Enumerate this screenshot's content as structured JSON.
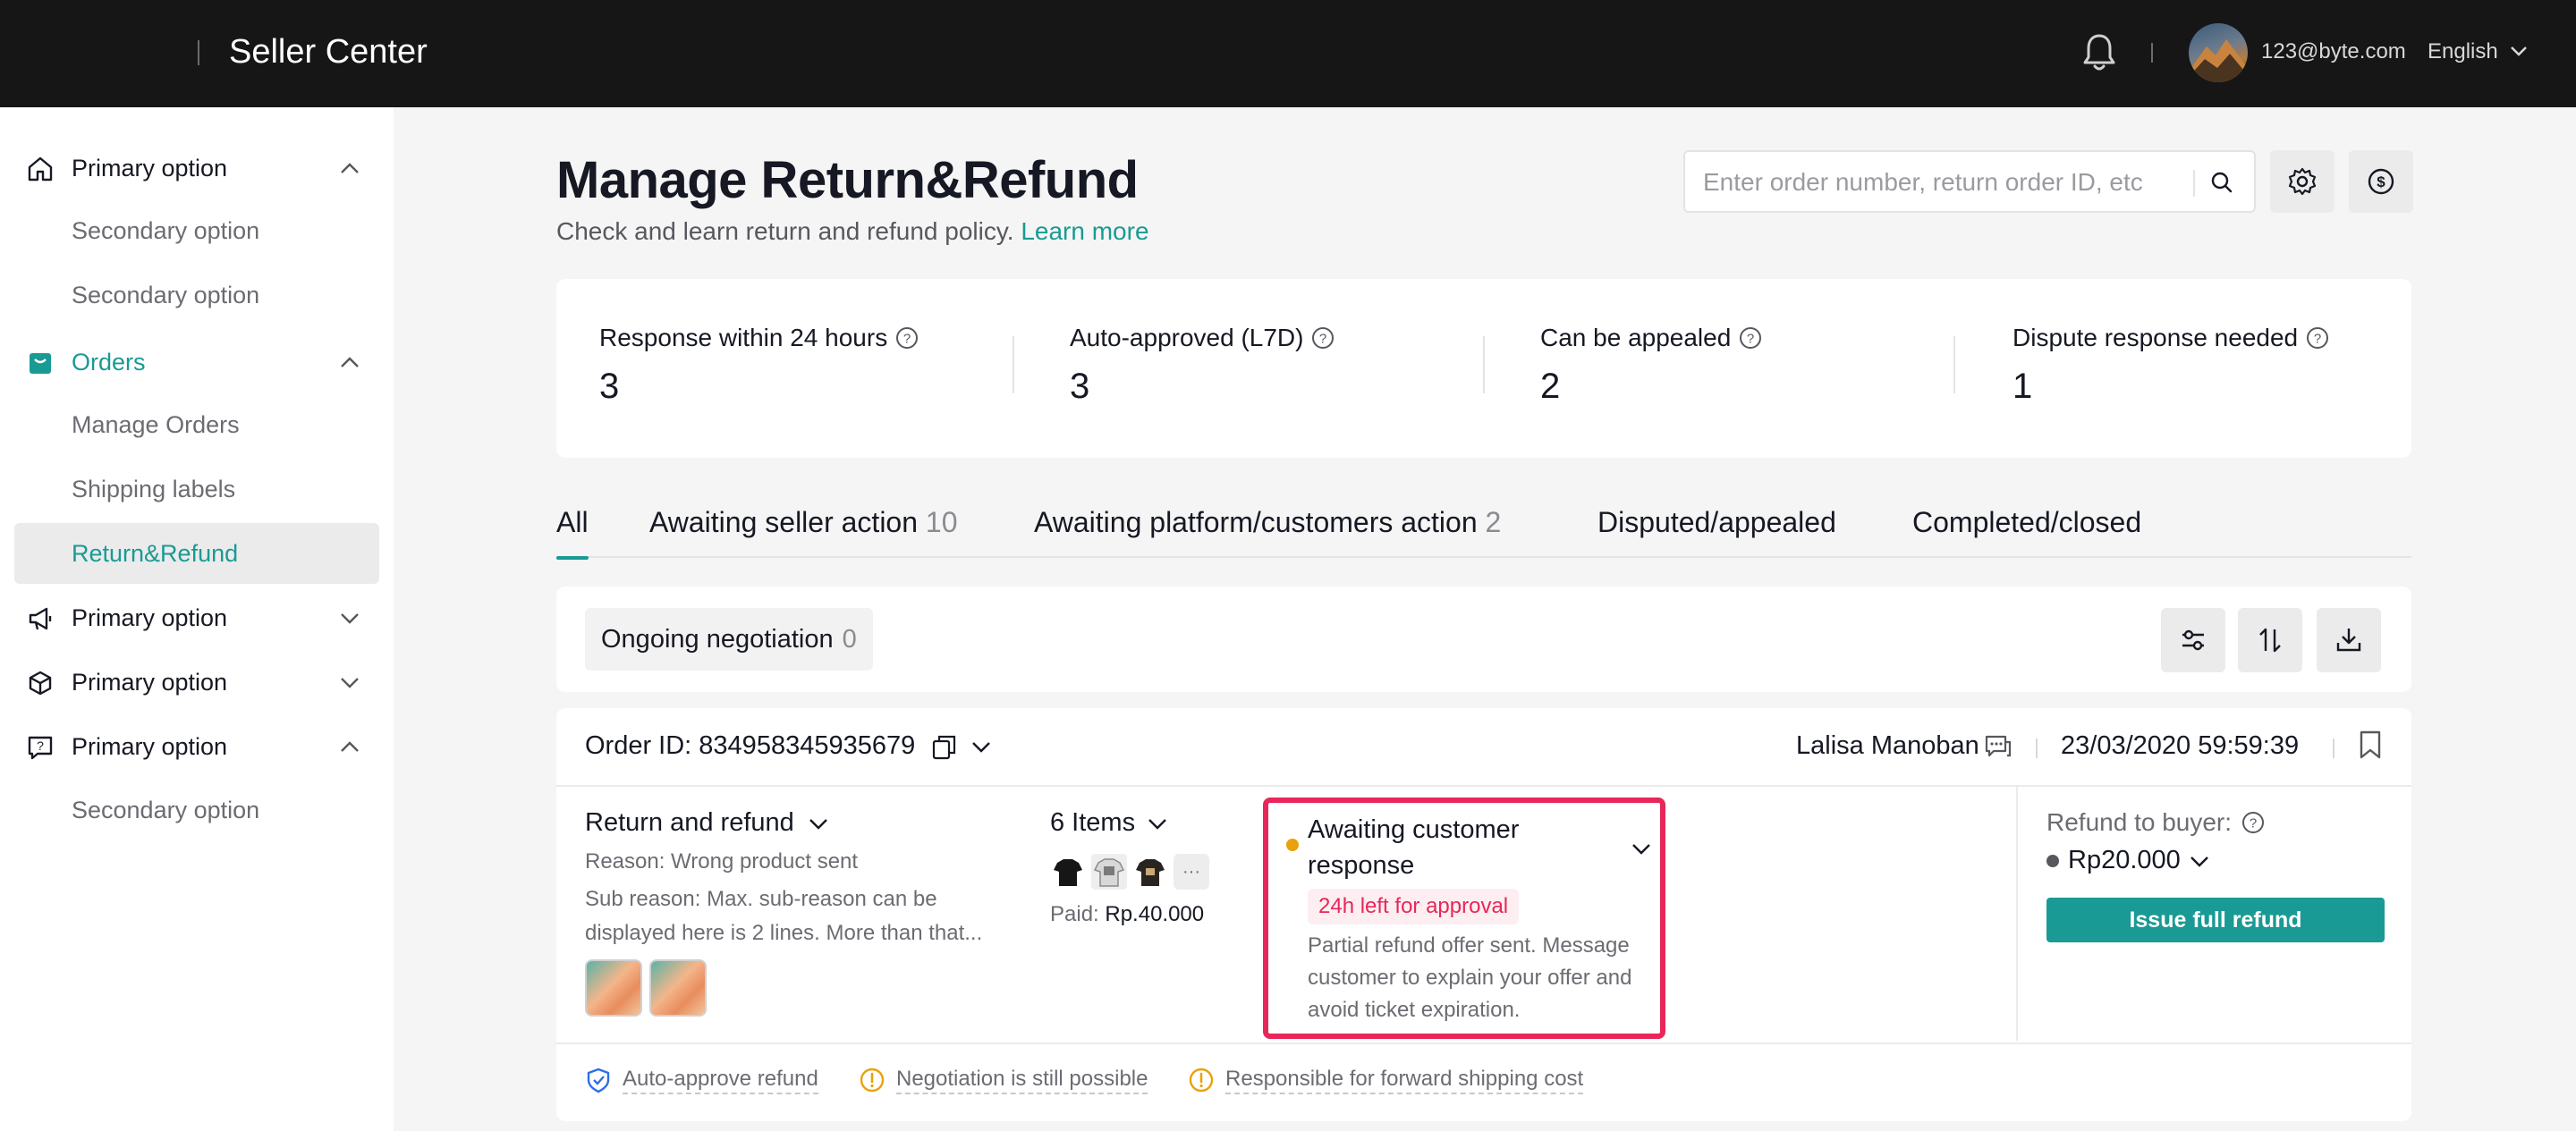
{
  "header": {
    "brand": "Seller Center",
    "email": "123@byte.com",
    "language": "English"
  },
  "sidebar": {
    "items": [
      {
        "label": "Primary option",
        "icon": "home-icon",
        "expanded": true
      },
      {
        "label": "Secondary option"
      },
      {
        "label": "Secondary option"
      },
      {
        "label": "Orders",
        "icon": "orders-icon",
        "expanded": true,
        "active": true
      },
      {
        "label": "Manage Orders"
      },
      {
        "label": "Shipping labels"
      },
      {
        "label": "Return&Refund",
        "active": true
      },
      {
        "label": "Primary option",
        "icon": "megaphone-icon",
        "expanded": false
      },
      {
        "label": "Primary option",
        "icon": "box-icon",
        "expanded": false
      },
      {
        "label": "Primary option",
        "icon": "help-chat-icon",
        "expanded": true
      },
      {
        "label": "Secondary option"
      }
    ]
  },
  "page": {
    "title": "Manage Return&Refund",
    "subtitle": "Check and learn return and refund policy.",
    "learn_more": "Learn more"
  },
  "search": {
    "placeholder": "Enter order number, return order ID, etc"
  },
  "stats": [
    {
      "label": "Response within 24 hours",
      "value": "3"
    },
    {
      "label": "Auto-approved (L7D)",
      "value": "3"
    },
    {
      "label": "Can be appealed",
      "value": "2"
    },
    {
      "label": "Dispute response needed",
      "value": "1"
    }
  ],
  "tabs": [
    {
      "label": "All",
      "count": ""
    },
    {
      "label": "Awaiting seller action",
      "count": "10"
    },
    {
      "label": "Awaiting platform/customers action",
      "count": "2"
    },
    {
      "label": "Disputed/appealed",
      "count": ""
    },
    {
      "label": "Completed/closed",
      "count": ""
    }
  ],
  "filter": {
    "chip_label": "Ongoing negotiation",
    "chip_count": "0"
  },
  "order": {
    "id_label": "Order ID: 834958345935679",
    "buyer": "Lalisa Manoban",
    "date": "23/03/2020 59:59:39",
    "type": "Return and refund",
    "reason": "Reason: Wrong product sent",
    "sub_reason": "Sub reason: Max. sub-reason can be displayed here is 2 lines. More than that...",
    "items": "6 Items",
    "more": "···",
    "paid_label": "Paid:",
    "paid_value": "Rp.40.000",
    "status": "Awaiting customer response",
    "status_tag": "24h left for approval",
    "status_desc": "Partial refund offer sent. Message customer to explain your offer and avoid ticket expiration.",
    "refund_label": "Refund to buyer:",
    "refund_amount": "Rp20.000",
    "issue_button": "Issue full refund",
    "flags": [
      {
        "label": "Auto-approve refund",
        "icon": "shield-check-icon",
        "color": "#2e6ee6"
      },
      {
        "label": "Negotiation is still possible",
        "icon": "warning-icon",
        "color": "#e8a20c"
      },
      {
        "label": "Responsible for forward shipping cost",
        "icon": "warning-icon",
        "color": "#e8a20c"
      }
    ]
  },
  "colors": {
    "accent": "#1a9a94",
    "highlight": "#e8265a",
    "topbar": "#161616"
  }
}
